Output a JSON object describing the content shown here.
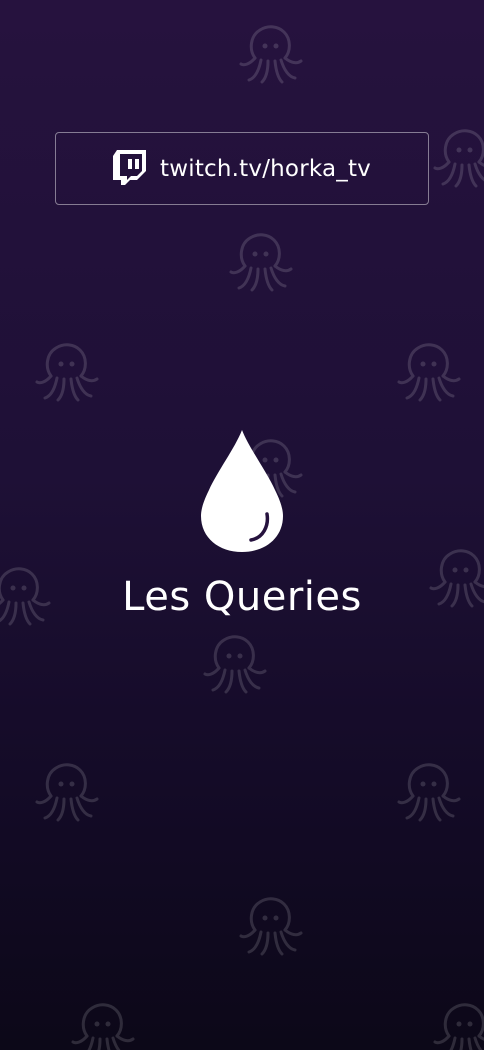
{
  "link": {
    "label": "twitch.tv/horka_tv",
    "icon": "twitch-icon"
  },
  "brand": {
    "icon": "water-drop-icon",
    "title": "Les Queries"
  },
  "background": {
    "pattern_icon": "octopus-icon"
  },
  "colors": {
    "background_top": "#26123e",
    "background_bottom": "#0c0818",
    "text": "#ffffff",
    "border": "#9a90a8"
  }
}
